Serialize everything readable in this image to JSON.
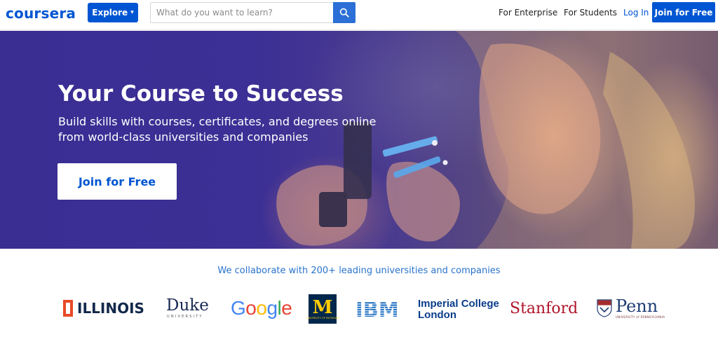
{
  "nav": {
    "logo": "coursera",
    "explore_label": "Explore",
    "search_placeholder": "What do you want to learn?",
    "enterprise_link": "For Enterprise",
    "students_link": "For Students",
    "login_link": "Log In",
    "join_label": "Join for Free"
  },
  "hero": {
    "title": "Your Course to Success",
    "subtitle_line1": "Build skills with courses, certificates, and degrees online",
    "subtitle_line2": "from world-class universities and companies",
    "cta_label": "Join for Free"
  },
  "partners": {
    "heading": "We collaborate with 200+ leading universities and companies",
    "illinois": "ILLINOIS",
    "duke_name": "Duke",
    "duke_sub": "UNIVERSITY",
    "google": "Google",
    "michigan_letter": "M",
    "michigan_sub": "UNIVERSITY OF MICHIGAN",
    "ibm": "IBM",
    "imperial_line1": "Imperial College",
    "imperial_line2": "London",
    "stanford": "Stanford",
    "penn_name": "Penn",
    "penn_sub": "UNIVERSITY of PENNSYLVANIA"
  },
  "colors": {
    "brand_blue": "#0056d2",
    "hero_purple": "#3a2e93",
    "collab_text": "#2a73cc"
  }
}
